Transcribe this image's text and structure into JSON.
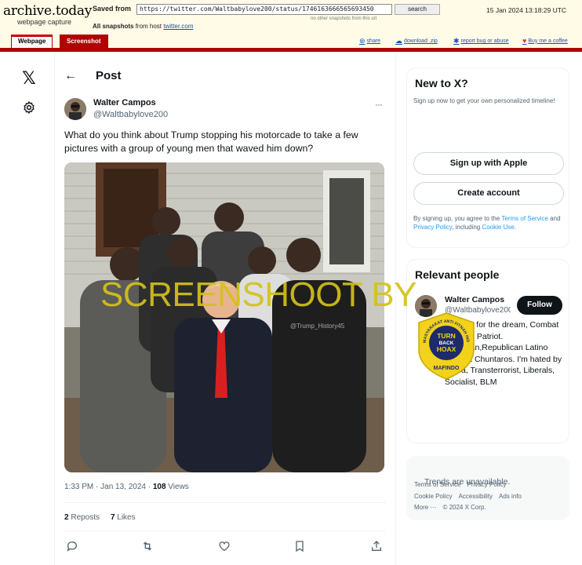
{
  "archive": {
    "logo": "archive.today",
    "logo_sub": "webpage capture",
    "saved_from_label": "Saved from",
    "url": "https://twitter.com/Waltbabylove200/status/1746163666565693450",
    "search_label": "search",
    "other_snapshots": "no other snapshots from this url",
    "all_snapshots_label": "All snapshots",
    "all_snapshots_from": "from host",
    "host": "twitter.com",
    "capture_date": "15 Jan 2024 13:18:29 UTC",
    "tabs": [
      "Webpage",
      "Screenshot"
    ],
    "actions": {
      "share": "share",
      "download": "download .zip",
      "report": "report bug or abuse",
      "coffee": "Buy me a coffee"
    }
  },
  "post": {
    "header_title": "Post",
    "author_name": "Walter Campos",
    "author_handle": "@Waltbabylove200",
    "text": "What do you think about Trump stopping his motorcade to take a few pictures with a group of young men that waved him down?",
    "photo_watermark": "@Trump_History45",
    "time": "1:33 PM · Jan 13, 2024 · ",
    "views_count": "108",
    "views_label": " Views",
    "reposts_count": "2",
    "reposts_label": " Reposts",
    "likes_count": "7",
    "likes_label": " Likes"
  },
  "overlay": {
    "screenshoot_text": "SCREENSHOOT BY",
    "badge_ring_text": "MASYARAKAT ANTI FITNAH INDONESIA",
    "badge_center": [
      "TURN",
      "BACK",
      "HOAX"
    ],
    "badge_bottom": "MAFINDO"
  },
  "sidebar": {
    "new_to_x_title": "New to X?",
    "new_to_x_sub": "Sign up now to get your own personalized timeline!",
    "apple_label": "Sign up with Apple",
    "create_account_label": "Create account",
    "terms_prefix": "By signing up, you agree to the ",
    "terms_link": "Terms of Service",
    "terms_and": " and ",
    "privacy_link": "Privacy Policy",
    "terms_incl": ", including ",
    "cookie_link": "Cookie Use",
    "terms_end": ".",
    "relevant_title": "Relevant people",
    "relevant_name": "Walter Campos",
    "relevant_handle": "@Waltbabylove200",
    "follow_label": "Follow",
    "relevant_bio": "Fighting for the dream, Combat veteran, Patriot. American,Republican Latino Against Chuntaros. I'm hated by Antifa, Transterrorist, Liberals, Socialist, BLM",
    "trends_text": "Trends are unavailable.",
    "footer": [
      "Terms of Service",
      "Privacy Policy",
      "Cookie Policy",
      "Accessibility",
      "Ads info",
      "More ···",
      "© 2024 X Corp."
    ]
  },
  "colors": {
    "archive_red": "#b30000",
    "x_blue": "#1d9bf0",
    "overlay_yellow": "#d4c11a",
    "badge_navy": "#1d2a6b"
  }
}
